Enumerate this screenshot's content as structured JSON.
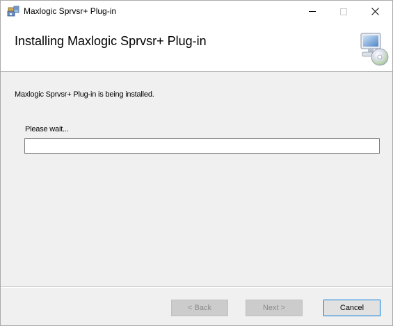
{
  "window": {
    "title": "Maxlogic Sprvsr+ Plug-in",
    "icons": {
      "app": "installer-package-icon",
      "minimize": "minimize-icon",
      "maximize": "maximize-icon",
      "close": "close-icon"
    }
  },
  "banner": {
    "title": "Installing Maxlogic Sprvsr+ Plug-in",
    "icon": "computer-cd-setup-icon"
  },
  "content": {
    "status": "Maxlogic Sprvsr+ Plug-in is being installed.",
    "wait_label": "Please wait...",
    "progress_fraction": 0
  },
  "footer": {
    "back_label": "< Back",
    "next_label": "Next >",
    "cancel_label": "Cancel"
  },
  "colors": {
    "face": "#f0f0f0",
    "accent_border": "#0078d7",
    "progress_fill": "#06b025"
  }
}
